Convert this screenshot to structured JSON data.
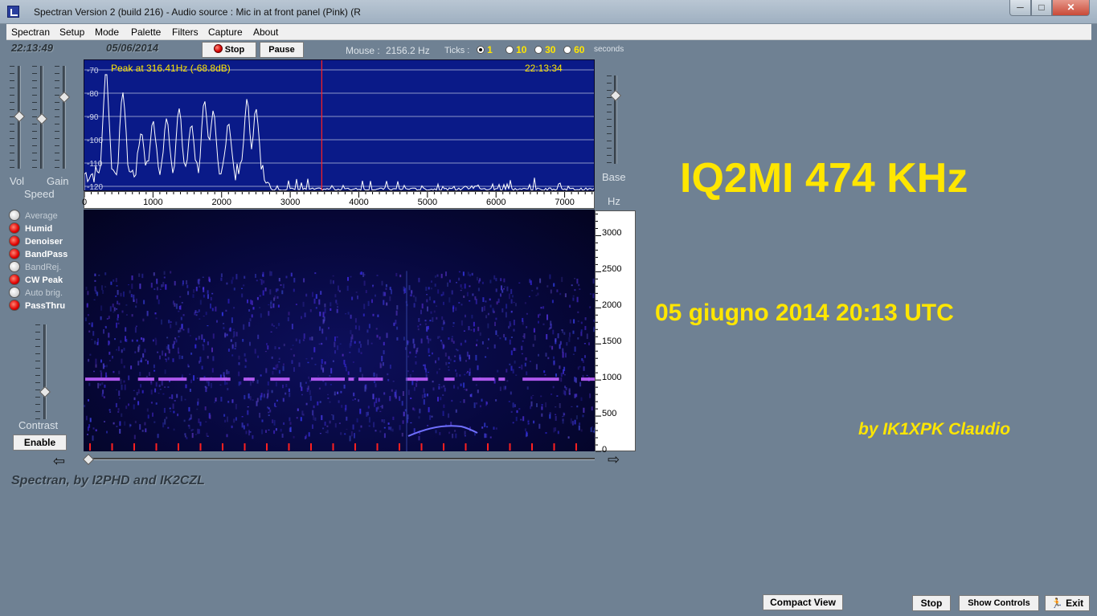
{
  "window": {
    "title": "Spectran Version 2 (build 216) - Audio source  :  Mic in at front panel (Pink) (R",
    "min_glyph": "─",
    "max_glyph": "□",
    "close_glyph": "✕"
  },
  "menu": [
    "Spectran",
    "Setup",
    "Mode",
    "Palette",
    "Filters",
    "Capture",
    "About"
  ],
  "toolbar": {
    "time": "22:13:49",
    "date": "05/06/2014",
    "stop_label": "Stop",
    "pause_label": "Pause",
    "mouse_label": "Mouse :",
    "mouse_value": "2156.2 Hz",
    "ticks_label": "Ticks :",
    "ticks": [
      "1",
      "10",
      "30",
      "60"
    ],
    "ticks_selected": "1",
    "seconds_label": "seconds"
  },
  "sliders": {
    "vol_label": "Vol",
    "gain_label": "Gain",
    "speed_label": "Speed",
    "base_label": "Base",
    "hz_label": "Hz",
    "contrast_label": "Contrast"
  },
  "filters": [
    {
      "label": "Average",
      "on": false
    },
    {
      "label": "Humid",
      "on": true
    },
    {
      "label": "Denoiser",
      "on": true
    },
    {
      "label": "BandPass",
      "on": true
    },
    {
      "label": "BandRej.",
      "on": false
    },
    {
      "label": "CW Peak",
      "on": true
    },
    {
      "label": "Auto brig.",
      "on": false
    },
    {
      "label": "PassThru",
      "on": true
    }
  ],
  "enable_label": "Enable",
  "spectrum": {
    "peak_text": "Peak at   316.41Hz (-68.8dB)",
    "time": "22:13:34",
    "db_labels": [
      "-70",
      "-80",
      "-90",
      "-100",
      "-110",
      "-120"
    ],
    "freq_labels": [
      "0",
      "1000",
      "2000",
      "3000",
      "4000",
      "5000",
      "6000",
      "7000"
    ],
    "cursor_hz": 3460
  },
  "waterfall": {
    "hz_labels": [
      "3000",
      "2500",
      "2000",
      "1500",
      "1000",
      "500",
      "0"
    ],
    "signal_hz": 1000
  },
  "credits": "Spectran, by I2PHD and IK2CZL",
  "overlay": {
    "callsign": "IQ2MI  474 KHz",
    "date_line": "05 giugno 2014  20:13 UTC",
    "author": "by IK1XPK Claudio"
  },
  "bottom_buttons": {
    "compact_view": "Compact View",
    "stop": "Stop",
    "show_controls": "Show Controls",
    "exit": "Exit"
  },
  "colors": {
    "background": "#6f8193",
    "spectrum_bg": "#0a1a88",
    "annotation": "#ffe600",
    "cursor": "#ff2020"
  }
}
